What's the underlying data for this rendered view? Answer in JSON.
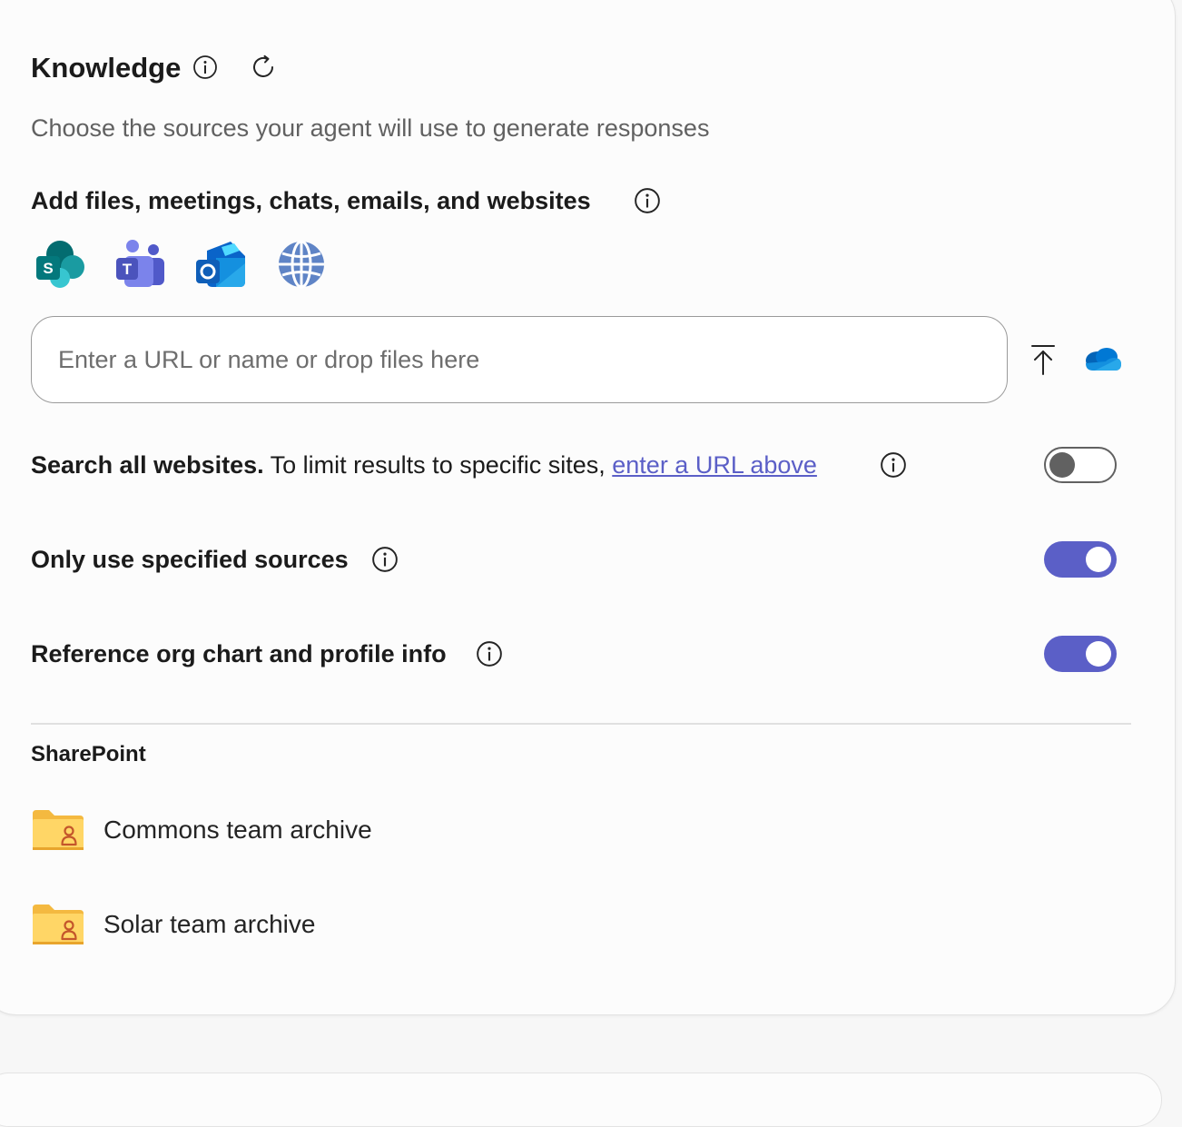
{
  "knowledge": {
    "title": "Knowledge",
    "subtitle": "Choose the sources your agent will use to generate responses",
    "add_heading": "Add files, meetings, chats, emails, and websites",
    "source_icons": [
      "sharepoint-icon",
      "teams-icon",
      "outlook-icon",
      "globe-icon"
    ],
    "input": {
      "placeholder": "Enter a URL or name or drop files here",
      "value": ""
    },
    "upload_icon": "upload-icon",
    "onedrive_icon": "onedrive-icon",
    "search_websites": {
      "bold": "Search all websites.",
      "text": " To limit results to specific sites, ",
      "link": "enter a URL above",
      "enabled": false
    },
    "only_specified": {
      "label": "Only use specified sources",
      "enabled": true
    },
    "org_chart": {
      "label": "Reference org chart and profile info",
      "enabled": true
    },
    "sharepoint": {
      "heading": "SharePoint",
      "items": [
        {
          "label": "Commons team archive",
          "icon": "shared-folder-icon"
        },
        {
          "label": "Solar team archive",
          "icon": "shared-folder-icon"
        }
      ]
    }
  },
  "colors": {
    "accent": "#5b5fc7",
    "text": "#242424",
    "muted": "#616161"
  }
}
